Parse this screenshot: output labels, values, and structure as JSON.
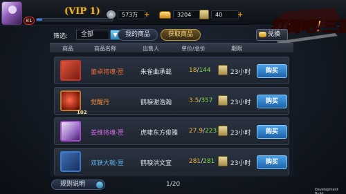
{
  "header": {
    "vip_text": "(VIP 1)",
    "level": "81",
    "exp_progress": 0.07,
    "silver": "573万",
    "gold": "3204",
    "scrolls": "40",
    "plus": "+"
  },
  "logo": {
    "title": "打倒吧!三国"
  },
  "filter": {
    "label": "筛选:",
    "selected": "全部",
    "arrow": "▼"
  },
  "tabs": {
    "my_goods": "我的商品",
    "get_goods": "获取商品",
    "exchange": "兑换"
  },
  "columns": {
    "goods": "商品",
    "goods_name": "商品名称",
    "seller": "出售人",
    "price": "单价/总价",
    "period": "期限"
  },
  "items": [
    {
      "name": "董卓将魂·匣",
      "name_color": "#f06a3a",
      "seller": "朱雀曲承载",
      "unit_price": "18",
      "total_price": "144",
      "period": "23小时",
      "buy_label": "购买",
      "qty": "",
      "icon": "dongzhuo-portrait-icon",
      "frame_color": "#c33a2a",
      "icon_bg": "linear-gradient(135deg,#e0553a,#7a1a12)"
    },
    {
      "name": "觉醒丹",
      "name_color": "#f08a3a",
      "seller": "鹤唳谢浩瀚",
      "unit_price": "3.5",
      "total_price": "357",
      "period": "23小时",
      "buy_label": "购买",
      "qty": "102",
      "icon": "awakening-pill-icon",
      "frame_color": "#c27a2a",
      "icon_bg": "radial-gradient(circle at 45% 45%,#ff6b4a,#8a1f10 70%,#2a0a05)"
    },
    {
      "name": "姜维将魂·匣",
      "name_color": "#d76ae8",
      "seller": "虎啸东方俊雅",
      "unit_price": "27.9",
      "total_price": "223",
      "period": "23小时",
      "buy_label": "购买",
      "qty": "",
      "icon": "jiangwei-portrait-icon",
      "frame_color": "#a24ad0",
      "icon_bg": "linear-gradient(135deg,#e9e2f5,#9a6cc4 60%,#3d2263)"
    },
    {
      "name": "双铁大戟·匣",
      "name_color": "#5cb2f0",
      "seller": "鹤唳洪文宣",
      "unit_price": "281",
      "total_price": "281",
      "period": "23小时",
      "buy_label": "购买",
      "qty": "",
      "icon": "halberd-box-icon",
      "frame_color": "#3a7bd0",
      "icon_bg": "linear-gradient(135deg,#3f6fb8,#1a2f5a)"
    }
  ],
  "footer": {
    "rules_label": "规则说明",
    "page": "1/20",
    "build": "Development Build"
  }
}
